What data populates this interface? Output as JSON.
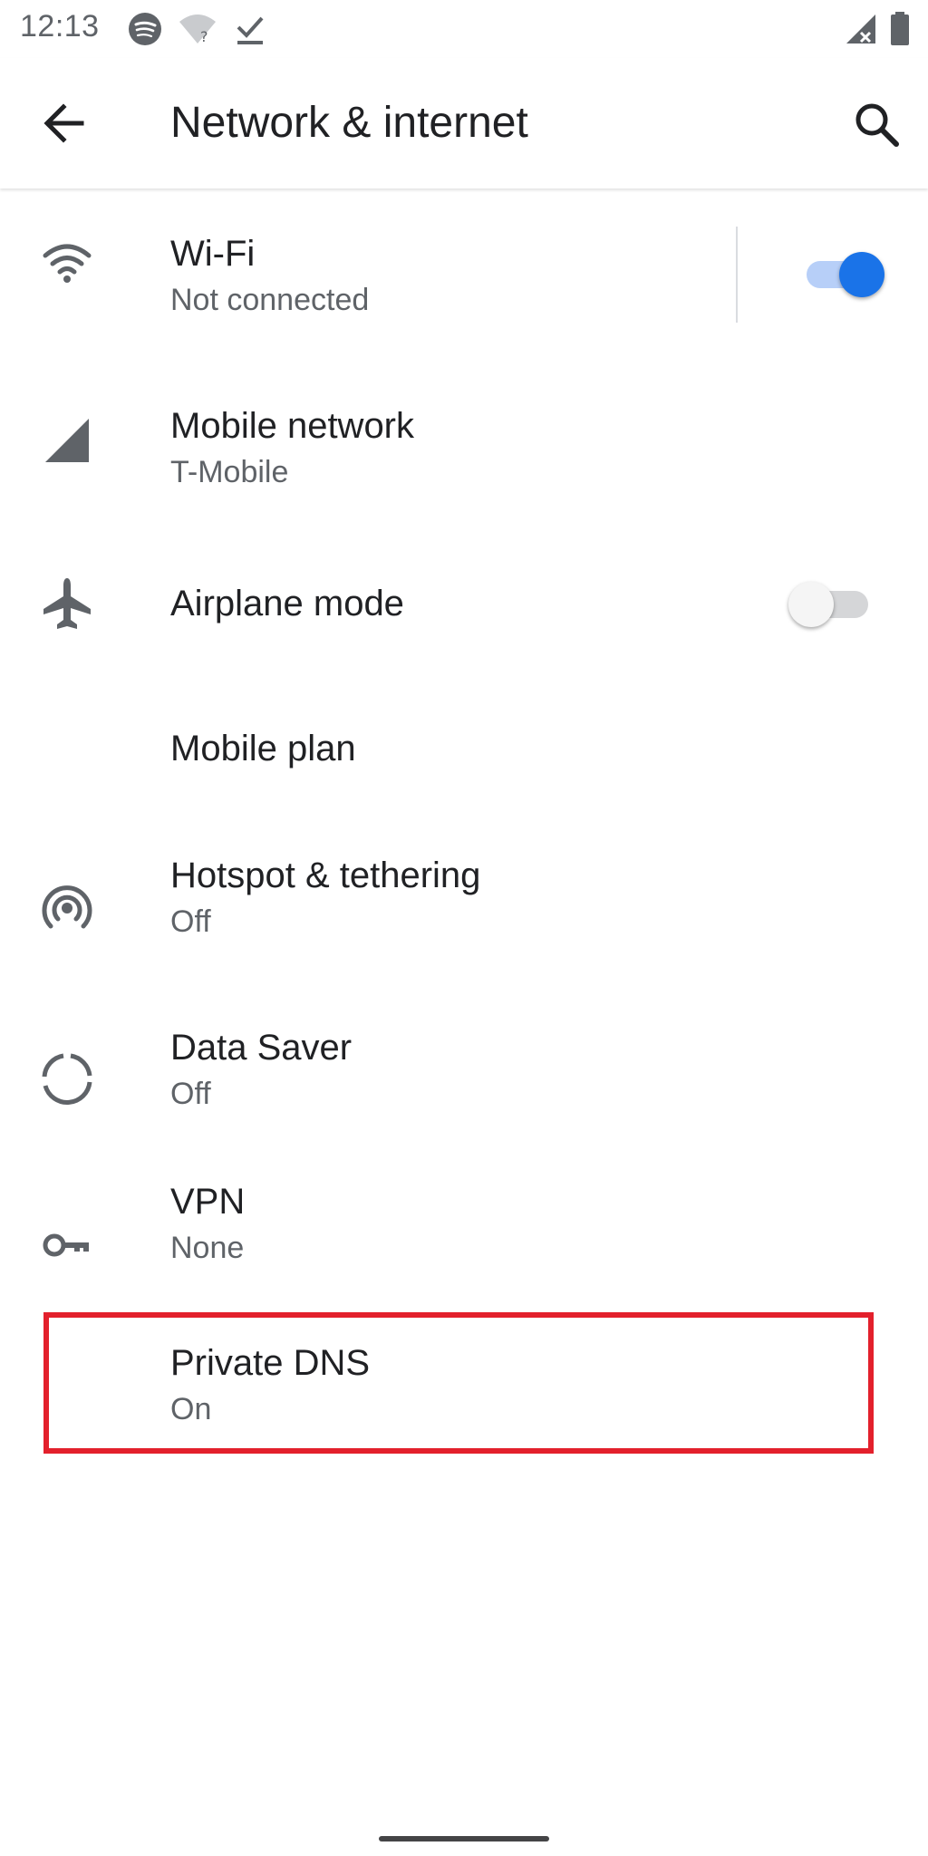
{
  "status_bar": {
    "time": "12:13",
    "icons": [
      "spotify-icon",
      "wifi-unknown-icon",
      "download-done-icon",
      "signal-no-data-icon",
      "battery-icon"
    ]
  },
  "app_bar": {
    "title": "Network & internet",
    "back_icon": "arrow-back-icon",
    "search_icon": "search-icon"
  },
  "settings": [
    {
      "id": "wifi",
      "title": "Wi-Fi",
      "subtitle": "Not connected",
      "icon": "wifi-icon",
      "toggle": true
    },
    {
      "id": "mobile-network",
      "title": "Mobile network",
      "subtitle": "T-Mobile",
      "icon": "signal-icon"
    },
    {
      "id": "airplane-mode",
      "title": "Airplane mode",
      "icon": "airplane-icon",
      "toggle": false
    },
    {
      "id": "mobile-plan",
      "title": "Mobile plan"
    },
    {
      "id": "hotspot",
      "title": "Hotspot & tethering",
      "subtitle": "Off",
      "icon": "hotspot-icon"
    },
    {
      "id": "data-saver",
      "title": "Data Saver",
      "subtitle": "Off",
      "icon": "data-saver-icon"
    },
    {
      "id": "vpn",
      "title": "VPN",
      "subtitle": "None",
      "icon": "vpn-key-icon"
    },
    {
      "id": "private-dns",
      "title": "Private DNS",
      "subtitle": "On",
      "highlighted": true
    }
  ],
  "colors": {
    "accent": "#1a73e8",
    "highlight": "#e3202c",
    "text_primary": "#202124",
    "text_secondary": "#5f6368",
    "icon": "#5f6368"
  }
}
